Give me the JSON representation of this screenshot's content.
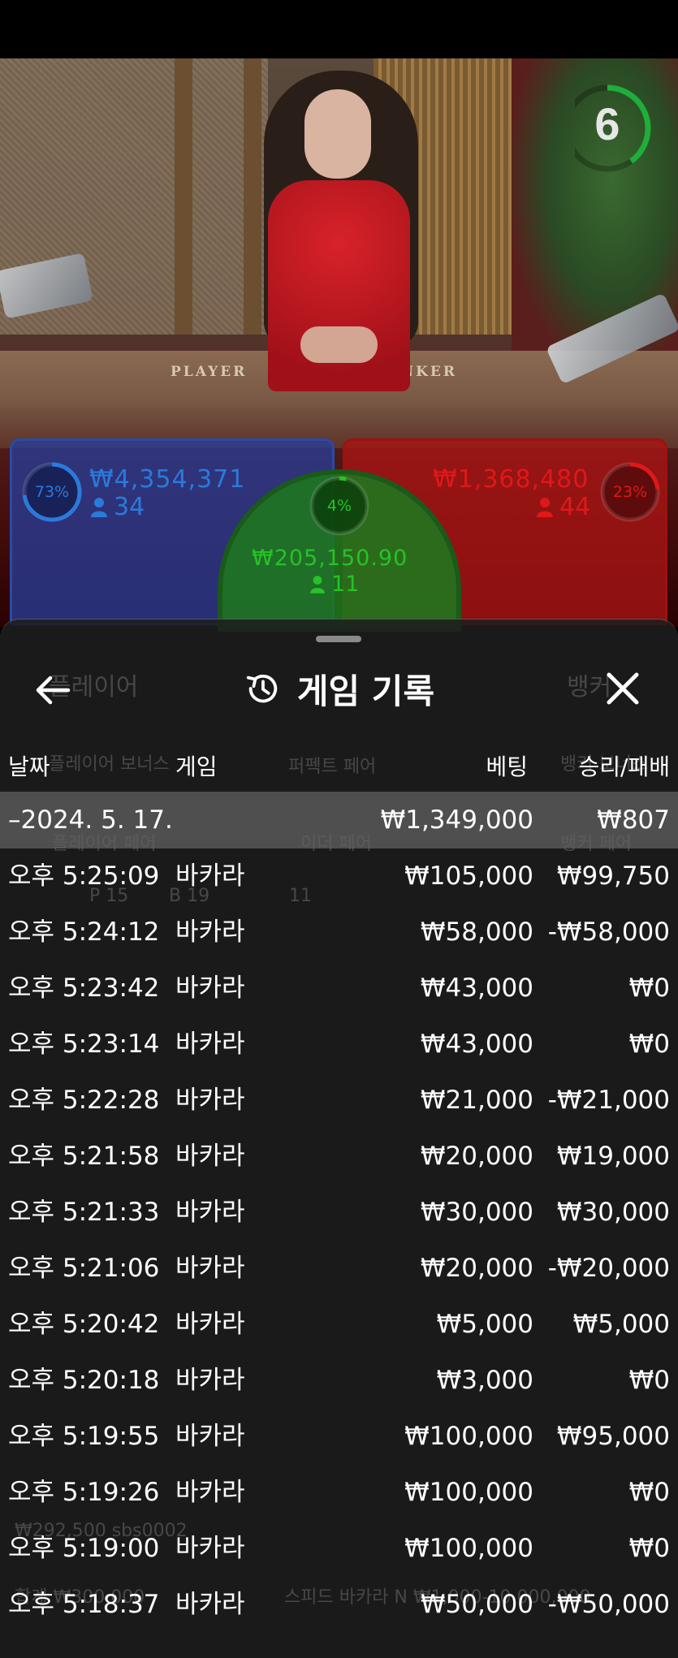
{
  "video": {
    "table_labels": {
      "player": "PLAYER",
      "banker": "BANKER"
    },
    "timer": {
      "value": "6",
      "fraction": 0.4,
      "color": "#1fae3a"
    }
  },
  "bets": {
    "player": {
      "percent_label": "73%",
      "percent": 73,
      "amount": "₩4,354,371",
      "count": "34",
      "color": "#2a7adc"
    },
    "tie": {
      "percent_label": "4%",
      "percent": 4,
      "amount": "₩205,150.90",
      "count": "11",
      "color": "#27c227"
    },
    "banker": {
      "percent_label": "23%",
      "percent": 23,
      "amount": "₩1,368,480",
      "count": "44",
      "color": "#e01818"
    }
  },
  "background_text": {
    "player_tab": "플레이어",
    "banker_tab": "뱅커",
    "player_bonus": "플레이어 보너스",
    "perfect_pair": "퍼펙트 페어",
    "banker_bonus": "뱅커 보너스",
    "player_pair": "플레이어 페어",
    "either_pair": "이더 페어",
    "banker_pair": "뱅커 페어",
    "stats_p": "P 15",
    "stats_b": "B 19",
    "stats_t": "11",
    "balance": "₩292,500 sbs0002",
    "total": "합계 ₩300,000",
    "table_name": "스피드 바카라 N ₩1,000-10,000,000"
  },
  "panel": {
    "title": "게임 기록",
    "icons": {
      "back": "arrow-left-icon",
      "history": "history-icon",
      "close": "close-icon"
    },
    "columns": {
      "date": "날짜",
      "game": "게임",
      "bet": "베팅",
      "result": "승리/패배"
    },
    "summary": {
      "date": "–2024. 5. 17.",
      "bet": "₩1,349,000",
      "result": "₩807"
    },
    "rows": [
      {
        "time": "오후 5:25:09",
        "game": "바카라",
        "bet": "₩105,000",
        "result": "₩99,750"
      },
      {
        "time": "오후 5:24:12",
        "game": "바카라",
        "bet": "₩58,000",
        "result": "-₩58,000"
      },
      {
        "time": "오후 5:23:42",
        "game": "바카라",
        "bet": "₩43,000",
        "result": "₩0"
      },
      {
        "time": "오후 5:23:14",
        "game": "바카라",
        "bet": "₩43,000",
        "result": "₩0"
      },
      {
        "time": "오후 5:22:28",
        "game": "바카라",
        "bet": "₩21,000",
        "result": "-₩21,000"
      },
      {
        "time": "오후 5:21:58",
        "game": "바카라",
        "bet": "₩20,000",
        "result": "₩19,000"
      },
      {
        "time": "오후 5:21:33",
        "game": "바카라",
        "bet": "₩30,000",
        "result": "₩30,000"
      },
      {
        "time": "오후 5:21:06",
        "game": "바카라",
        "bet": "₩20,000",
        "result": "-₩20,000"
      },
      {
        "time": "오후 5:20:42",
        "game": "바카라",
        "bet": "₩5,000",
        "result": "₩5,000"
      },
      {
        "time": "오후 5:20:18",
        "game": "바카라",
        "bet": "₩3,000",
        "result": "₩0"
      },
      {
        "time": "오후 5:19:55",
        "game": "바카라",
        "bet": "₩100,000",
        "result": "₩95,000"
      },
      {
        "time": "오후 5:19:26",
        "game": "바카라",
        "bet": "₩100,000",
        "result": "₩0"
      },
      {
        "time": "오후 5:19:00",
        "game": "바카라",
        "bet": "₩100,000",
        "result": "₩0"
      },
      {
        "time": "오후 5:18:37",
        "game": "바카라",
        "bet": "₩50,000",
        "result": "-₩50,000"
      }
    ]
  }
}
